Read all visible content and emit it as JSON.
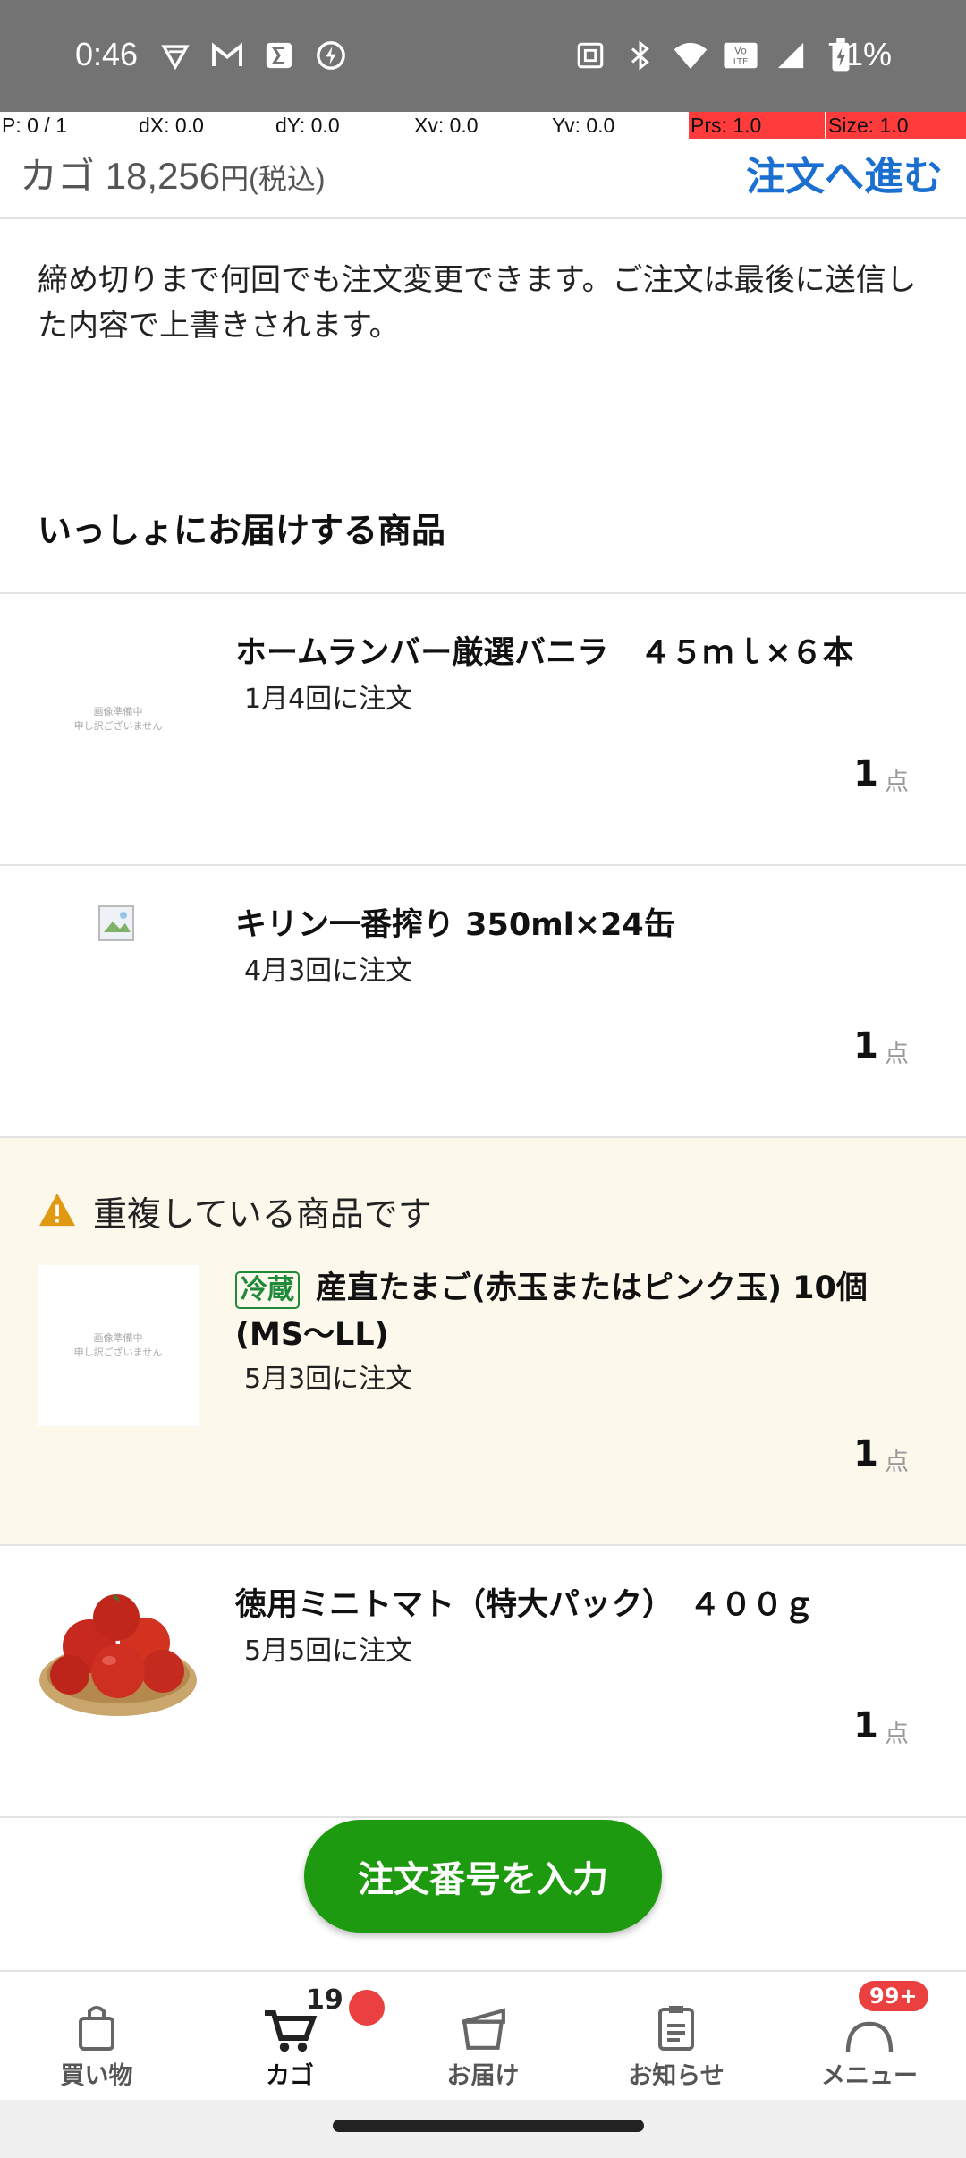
{
  "status_bar": {
    "time": "0:46",
    "battery": "71%",
    "left_icons": [
      "vpn-shield-icon",
      "gmail-icon",
      "sigma-app-icon",
      "lightning-icon"
    ],
    "right_icons": [
      "nfc-icon",
      "bluetooth-icon",
      "wifi-icon",
      "volte-icon",
      "signal-icon",
      "battery-charging-icon"
    ]
  },
  "debug_overlay": {
    "p": "P: 0 / 1",
    "dx": "dX: 0.0",
    "dy": "dY: 0.0",
    "xv": "Xv: 0.0",
    "yv": "Yv: 0.0",
    "prs": "Prs: 1.0",
    "size": "Size: 1.0"
  },
  "header": {
    "cart_label": "カゴ",
    "cart_amount": "18,256",
    "cart_unit": "円",
    "tax_note": "(税込)",
    "proceed_label": "注文へ進む"
  },
  "notice": "締め切りまで何回でも注文変更できます。ご注文は最後に送信した内容で上書きされます。",
  "section_title": "いっしょにお届けする商品",
  "placeholder_text": [
    "画像準備中",
    "申し訳ございません"
  ],
  "items": [
    {
      "name": "ホームランバー厳選バニラ　４５ｍｌ×６本",
      "order_date": "1月4回に注文",
      "qty": "1",
      "unit": "点"
    },
    {
      "name": "キリン一番搾り 350ml×24缶",
      "order_date": "4月3回に注文",
      "qty": "1",
      "unit": "点"
    },
    {
      "tag": "冷蔵",
      "name": "産直たまご(赤玉またはピンク玉) 10個(MS〜LL)",
      "order_date": "5月3回に注文",
      "qty": "1",
      "unit": "点"
    },
    {
      "name": "徳用ミニトマト（特大パック）　４００ｇ",
      "order_date": "5月5回に注文",
      "qty": "1",
      "unit": "点"
    }
  ],
  "duplicate_warning": "重複している商品です",
  "fab_label": "注文番号を入力",
  "bottom_nav": {
    "shopping": "買い物",
    "cart": "カゴ",
    "cart_count": "19",
    "delivery": "お届け",
    "news": "お知らせ",
    "menu": "メニュー",
    "menu_badge": "99+"
  },
  "colors": {
    "accent_blue": "#1a6fd1",
    "fab_green": "#1e9a10",
    "warning_bg": "#fcf8ec",
    "badge_red": "#ea4040"
  }
}
